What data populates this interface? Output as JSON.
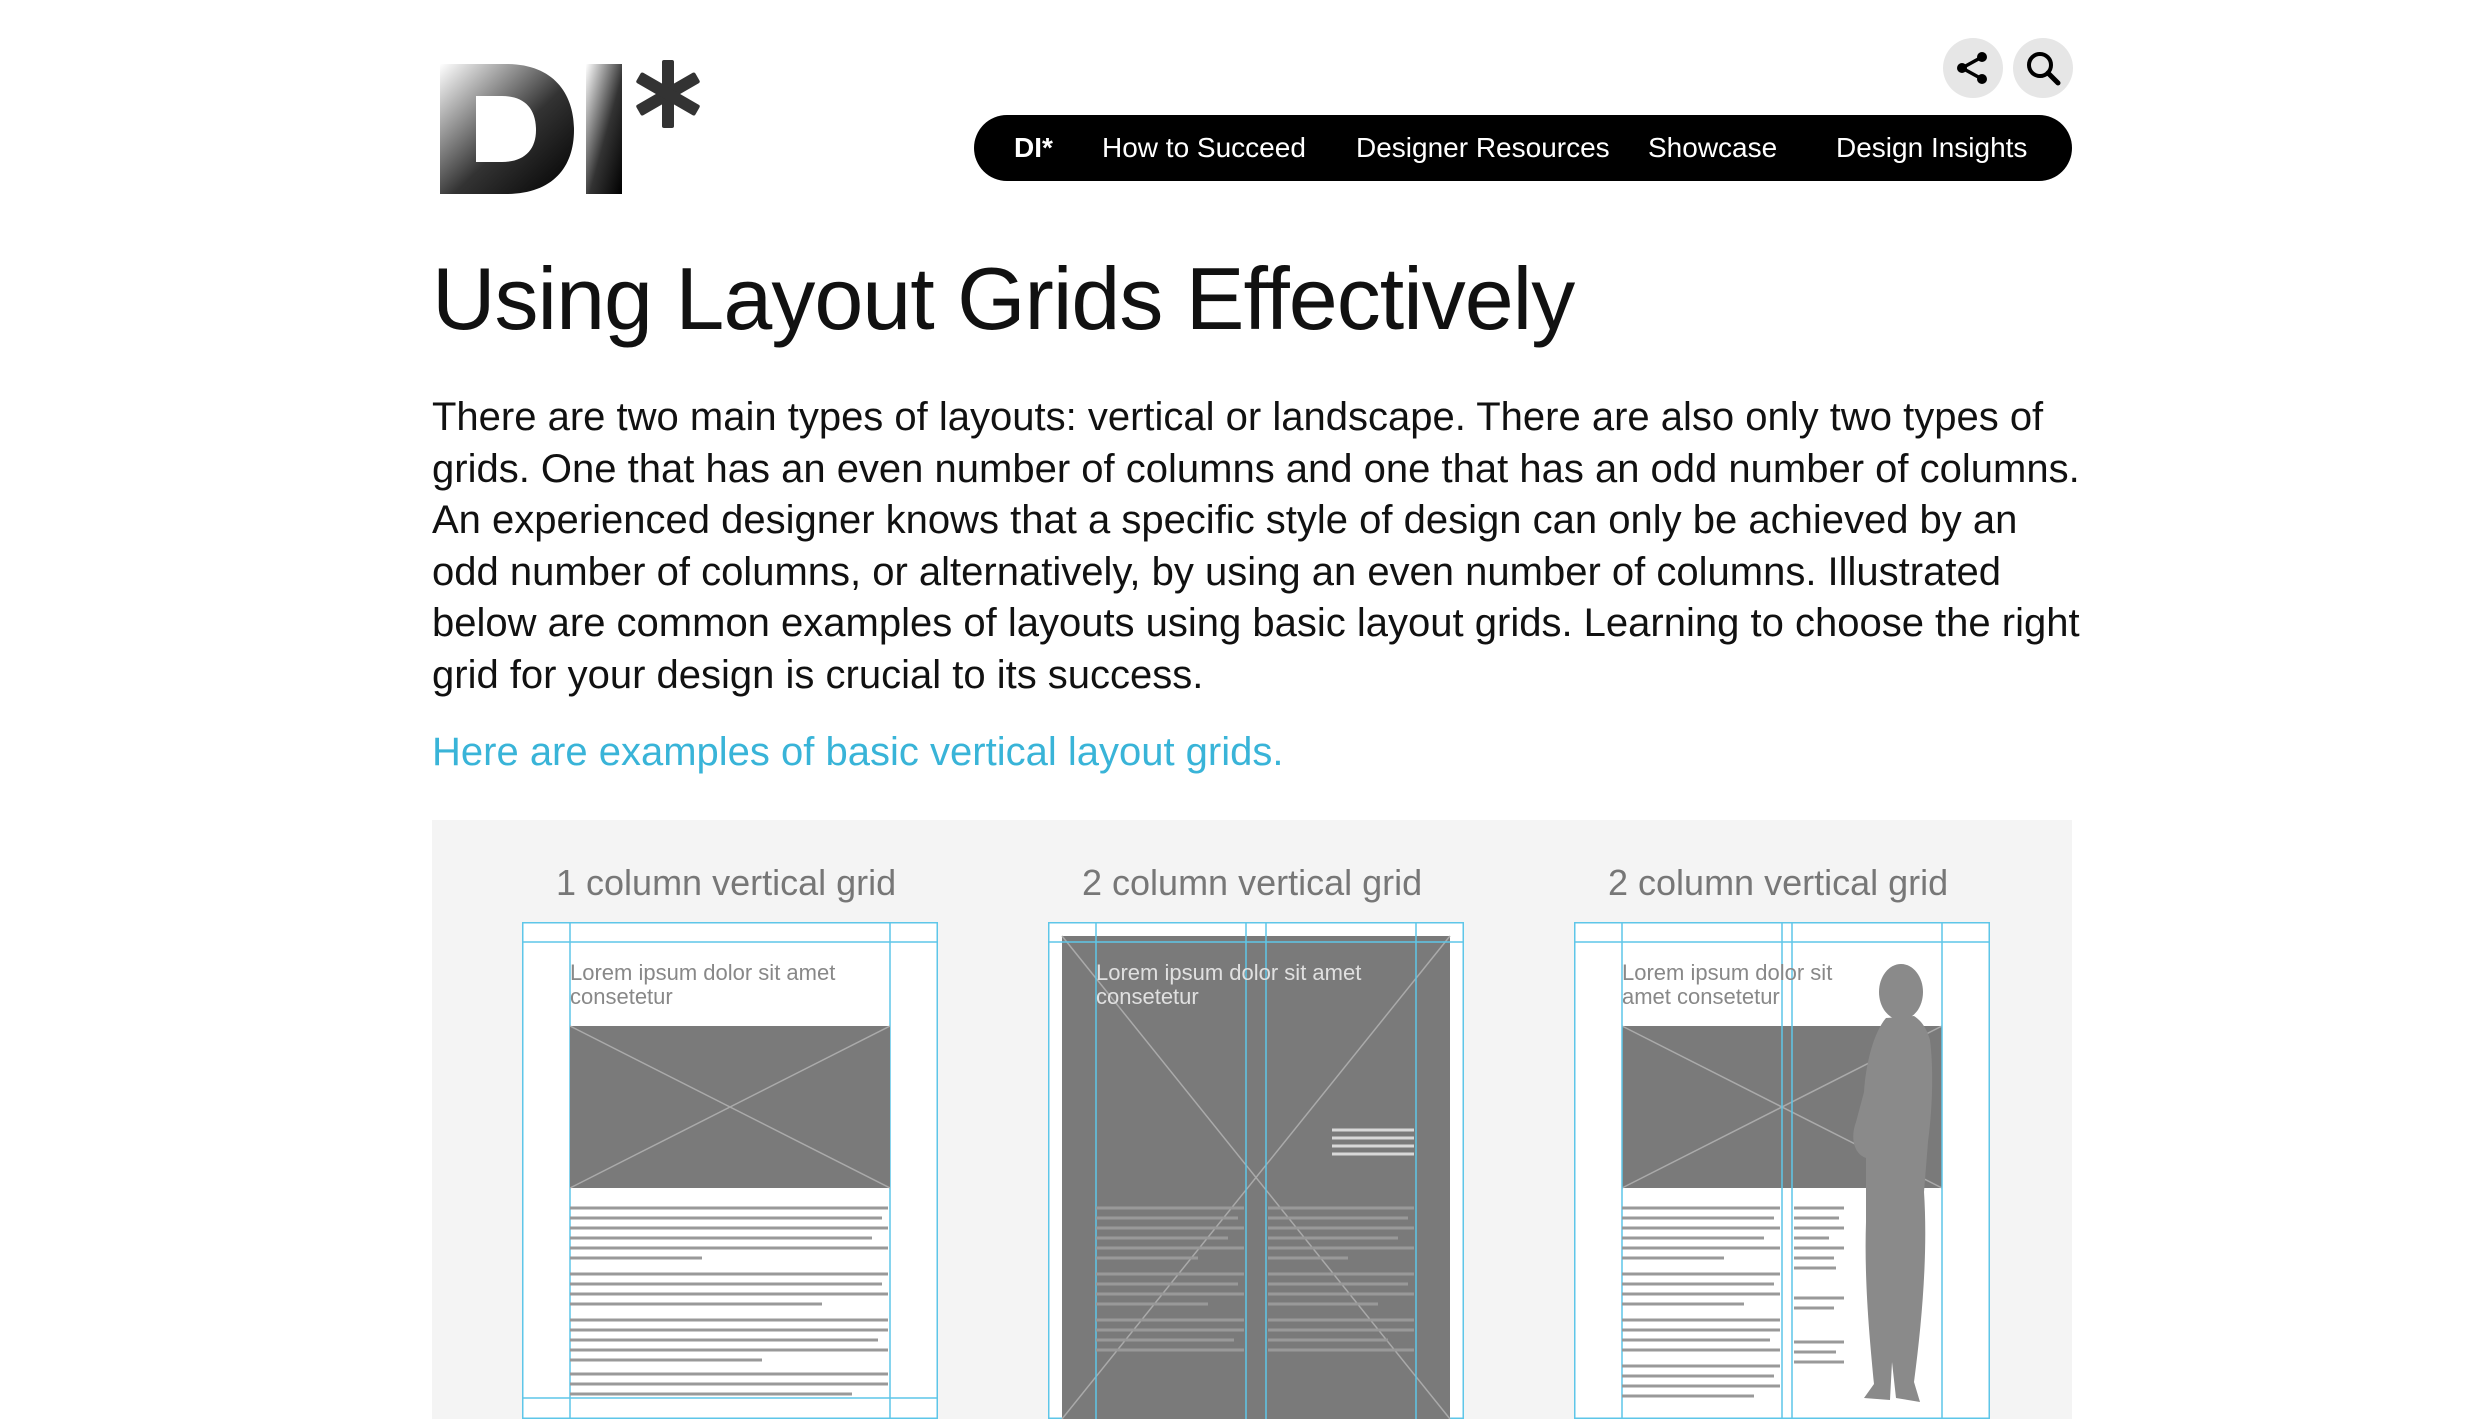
{
  "brand": {
    "logo_text": "DI*",
    "colors": {
      "accent_link": "#39b4d8",
      "nav_bg": "#000000",
      "panel_bg": "#f4f4f4",
      "diagram_gray": "#7a7a7a",
      "grid_line": "#5ec6e8"
    }
  },
  "header": {
    "share_icon": "share-icon",
    "search_icon": "search-icon"
  },
  "nav": {
    "items": [
      {
        "label": "DI*"
      },
      {
        "label": "How to Succeed"
      },
      {
        "label": "Designer Resources"
      },
      {
        "label": "Showcase"
      },
      {
        "label": "Design Insights"
      }
    ]
  },
  "main": {
    "title": "Using Layout Grids Effectively",
    "intro": "There are two main types of layouts: vertical or landscape. There are also only two types of grids. One that has an even number of columns and one that has an odd number of columns. An experienced designer knows that a specific style of design can only be achieved by an odd number of columns, or alternatively, by using an even number of columns. Illustrated below are common examples of layouts using basic layout grids. Learning to choose the right grid for your design is crucial to its success.",
    "subheading_link": "Here are examples of basic vertical layout grids."
  },
  "examples": [
    {
      "caption": "1 column vertical grid",
      "headline": "Lorem ipsum dolor sit amet consetetur"
    },
    {
      "caption": "2 column vertical grid",
      "headline": "Lorem ipsum dolor sit amet consetetur"
    },
    {
      "caption": "2 column vertical grid",
      "headline": "Lorem ipsum dolor sit amet consetetur"
    }
  ]
}
